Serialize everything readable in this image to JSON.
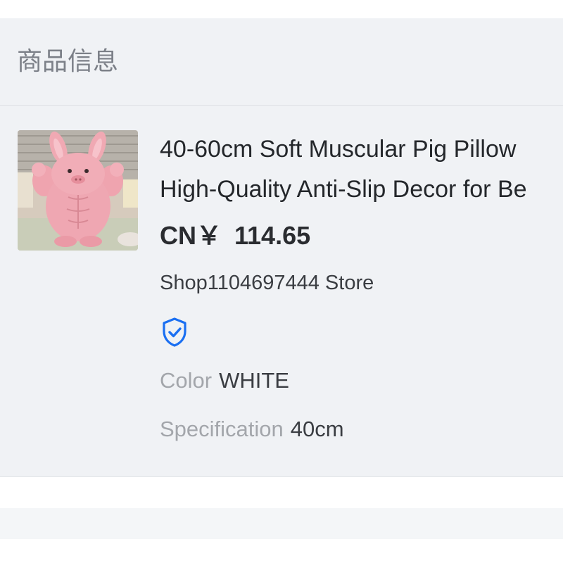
{
  "section": {
    "title": "商品信息"
  },
  "product": {
    "image_alt": "pink muscular plush toy",
    "title_line1": "40-60cm Soft Muscular Pig Pillow",
    "title_line2": "High-Quality Anti-Slip Decor for Be",
    "price_currency": "CN￥",
    "price_amount": "114.65",
    "store_name": "Shop1104697444 Store",
    "verified_icon": "shield-check-icon",
    "attributes": [
      {
        "key": "Color",
        "value": "WHITE"
      },
      {
        "key": "Specification",
        "value": "40cm"
      }
    ]
  },
  "colors": {
    "accent": "#1a6ff2",
    "panel_bg": "#f0f2f5"
  }
}
